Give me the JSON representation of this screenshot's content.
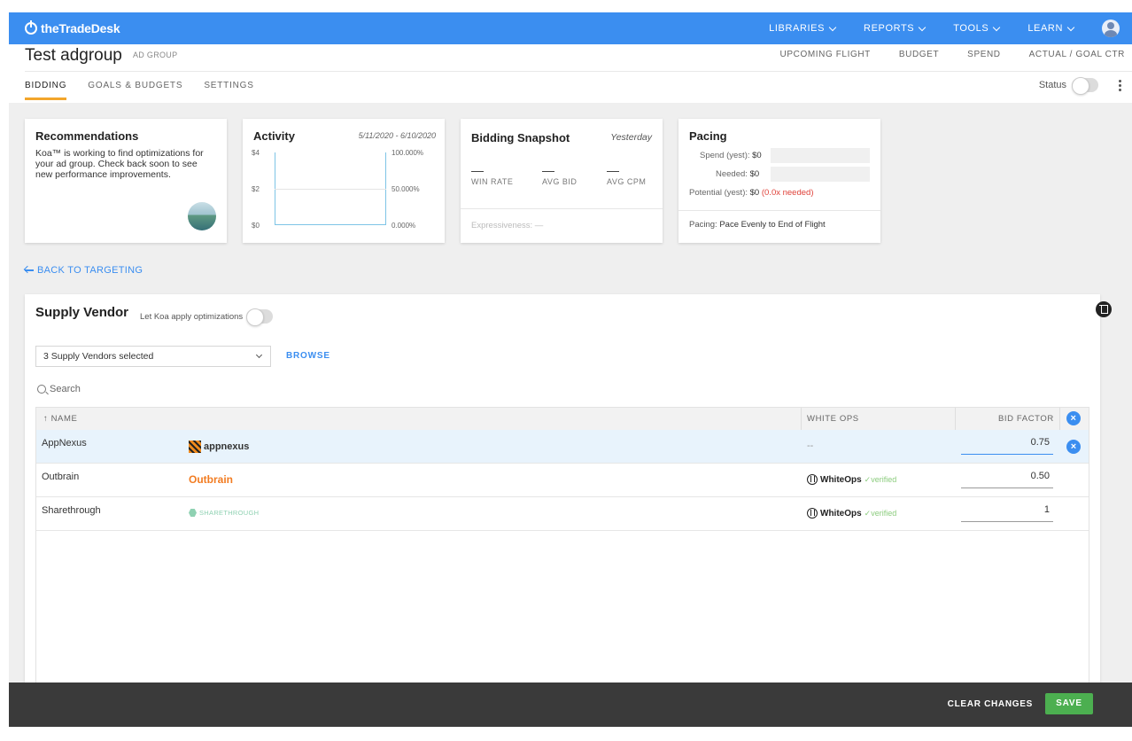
{
  "topbar": {
    "logo": "theTradeDesk",
    "nav": [
      "LIBRARIES",
      "REPORTS",
      "TOOLS",
      "LEARN"
    ],
    "color": "#3b8ef0"
  },
  "header": {
    "title": "Test adgroup",
    "subtitle": "AD GROUP",
    "links": [
      "UPCOMING FLIGHT",
      "BUDGET",
      "SPEND",
      "ACTUAL / GOAL CTR"
    ],
    "tabs": [
      "BIDDING",
      "GOALS & BUDGETS",
      "SETTINGS"
    ],
    "active_tab": "BIDDING",
    "status_label": "Status"
  },
  "recommendations": {
    "title": "Recommendations",
    "text": "Koa™ is working to find optimizations for your ad group. Check back soon to see new performance improvements."
  },
  "activity": {
    "title": "Activity",
    "date_range": "5/11/2020 - 6/10/2020",
    "left_ticks": [
      "$4",
      "$2",
      "$0"
    ],
    "right_ticks": [
      "100.000%",
      "50.000%",
      "0.000%"
    ]
  },
  "snapshot": {
    "title": "Bidding Snapshot",
    "period": "Yesterday",
    "metrics": [
      {
        "value": "—",
        "label": "WIN RATE"
      },
      {
        "value": "—",
        "label": "AVG BID"
      },
      {
        "value": "—",
        "label": "AVG CPM"
      }
    ],
    "expressiveness": "Expressiveness: —"
  },
  "pacing": {
    "title": "Pacing",
    "spend_label": "Spend (yest):",
    "spend_value": "$0",
    "needed_label": "Needed:",
    "needed_value": "$0",
    "potential_label": "Potential (yest):",
    "potential_value": "$0",
    "potential_note": "(0.0x needed)",
    "footer_label": "Pacing:",
    "footer_value": "Pace Evenly to End of Flight"
  },
  "back_link": "BACK TO TARGETING",
  "supply_vendor": {
    "title": "Supply Vendor",
    "koa_label": "Let Koa apply optimizations",
    "select_value": "3 Supply Vendors selected",
    "browse": "BROWSE",
    "search_placeholder": "Search",
    "columns": {
      "name": "NAME",
      "white_ops": "WHITE OPS",
      "bid_factor": "BID FACTOR"
    },
    "rows": [
      {
        "name": "AppNexus",
        "logo": "appnexus",
        "white_ops": "--",
        "bid_factor": "0.75"
      },
      {
        "name": "Outbrain",
        "logo": "Outbrain",
        "white_ops": "WhiteOps",
        "verified": "✓verified",
        "bid_factor": "0.50"
      },
      {
        "name": "Sharethrough",
        "logo": "SHARETHROUGH",
        "white_ops": "WhiteOps",
        "verified": "✓verified",
        "bid_factor": "1"
      }
    ]
  },
  "footer": {
    "clear": "CLEAR CHANGES",
    "save": "SAVE",
    "save_color": "#4caf50"
  }
}
